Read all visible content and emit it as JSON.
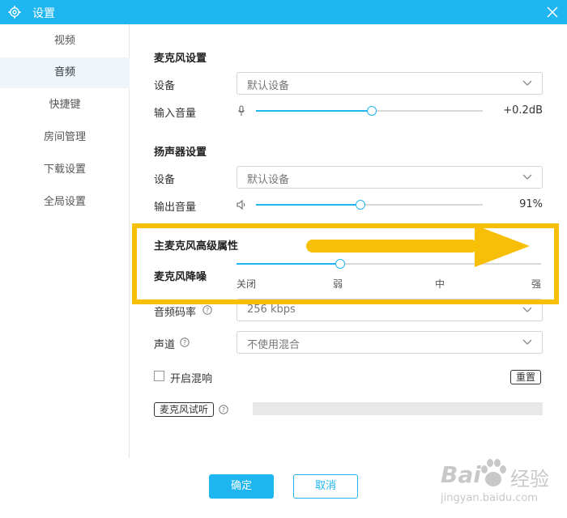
{
  "window": {
    "title": "设置"
  },
  "sidebar": {
    "items": [
      {
        "label": "视频",
        "active": false
      },
      {
        "label": "音频",
        "active": true
      },
      {
        "label": "快捷键",
        "active": false
      },
      {
        "label": "房间管理",
        "active": false
      },
      {
        "label": "下载设置",
        "active": false
      },
      {
        "label": "全局设置",
        "active": false
      }
    ]
  },
  "mic": {
    "section_title": "麦克风设置",
    "device_label": "设备",
    "device_value": "默认设备",
    "volume_label": "输入音量",
    "volume_readout": "+0.2dB",
    "volume_level": 0.51
  },
  "speaker": {
    "section_title": "扬声器设置",
    "device_label": "设备",
    "device_value": "默认设备",
    "volume_label": "输出音量",
    "volume_readout": "91%",
    "volume_level": 0.46
  },
  "advanced": {
    "section_title": "主麦克风高级属性",
    "noise_label": "麦克风降噪",
    "noise_level": 0.34,
    "ticks": [
      "关闭",
      "弱",
      "中",
      "强"
    ]
  },
  "audio": {
    "bitrate_label": "音频码率",
    "bitrate_value": "256 kbps",
    "channel_label": "声道",
    "channel_value": "不使用混合",
    "reverb_label": "开启混响",
    "reset_label": "重置",
    "mic_test_label": "麦克风试听"
  },
  "footer": {
    "ok_label": "确定",
    "cancel_label": "取消"
  },
  "watermark": {
    "brand": "Bai",
    "brand_cn": "经验",
    "url": "jingyan.baidu.com"
  },
  "colors": {
    "accent": "#1fb5f0",
    "highlight": "#f7bf08"
  }
}
